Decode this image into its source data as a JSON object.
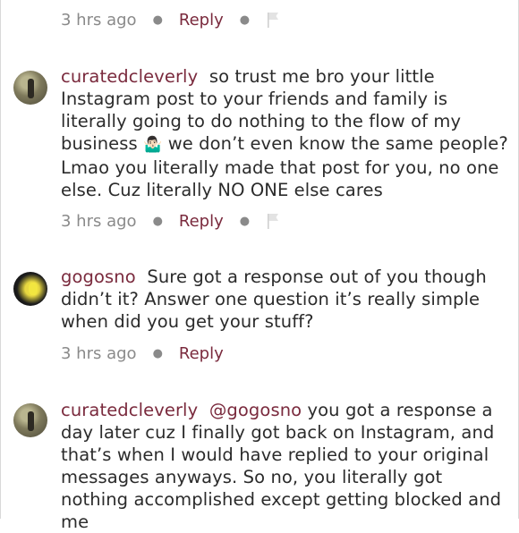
{
  "comments": [
    {
      "meta": {
        "time": "3 hrs ago",
        "reply": "Reply",
        "flag": "flag-icon"
      }
    },
    {
      "user": "curatedcleverly",
      "text_before_emoji": "so trust me bro your little Instagram post to your friends and family is literally going to do nothing to the flow of my business",
      "emoji": "🤷🏻‍♂️",
      "text_after_emoji": "we don’t even know the same people? Lmao you literally made that post for you, no one else. Cuz literally NO ONE else cares",
      "meta": {
        "time": "3 hrs ago",
        "reply": "Reply",
        "flag": "flag-icon"
      }
    },
    {
      "user": "gogosno",
      "text": "Sure got a response out of you though didn’t it? Answer one question it’s really simple when did you get your stuff?",
      "meta": {
        "time": "3 hrs ago",
        "reply": "Reply"
      }
    },
    {
      "user": "curatedcleverly",
      "mention": "@gogosno",
      "text": "you got a response a day later cuz I finally got back on Instagram, and that’s when I would have replied to your original messages anyways. So no, you literally got nothing accomplished except getting blocked and me"
    }
  ],
  "colors": {
    "accent": "#7a2a3d",
    "muted": "#8a8a8a",
    "text": "#2b2b2b"
  }
}
